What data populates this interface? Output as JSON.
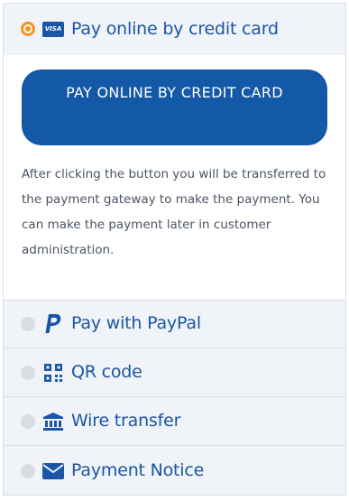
{
  "payment_methods": [
    {
      "label": "Pay online by credit card",
      "icon": "visa-card-icon",
      "badge_text": "VISA",
      "selected": true
    },
    {
      "label": "Pay with PayPal",
      "icon": "paypal-icon",
      "selected": false
    },
    {
      "label": "QR code",
      "icon": "qr-code-icon",
      "selected": false
    },
    {
      "label": "Wire transfer",
      "icon": "bank-icon",
      "selected": false
    },
    {
      "label": "Payment Notice",
      "icon": "envelope-icon",
      "selected": false
    }
  ],
  "credit_card_panel": {
    "button_label": "PAY ONLINE BY CREDIT CARD",
    "description": "After clicking the button you will be transferred to the payment gateway to make the payment. You can make the payment later in customer administration."
  },
  "colors": {
    "brand_blue": "#1a56a5",
    "selected_radio": "#f39421",
    "row_background": "#f0f3f7"
  }
}
